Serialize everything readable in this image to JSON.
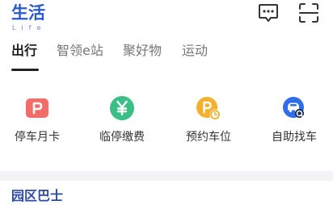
{
  "header": {
    "title": "生活",
    "subtitle": "Life",
    "icons": {
      "message": "message-icon",
      "scan": "scan-icon"
    },
    "brand_color": "#2a58d3"
  },
  "tabs": [
    {
      "label": "出行",
      "active": true
    },
    {
      "label": "智领e站",
      "active": false
    },
    {
      "label": "聚好物",
      "active": false
    },
    {
      "label": "运动",
      "active": false
    }
  ],
  "services": [
    {
      "label": "停车月卡",
      "icon": "parking-card-icon",
      "color": "#f26d6a"
    },
    {
      "label": "临停缴费",
      "icon": "yuan-icon",
      "color": "#3bbf86"
    },
    {
      "label": "预约车位",
      "icon": "parking-reserve-icon",
      "color": "#f5b02d"
    },
    {
      "label": "自助找车",
      "icon": "find-car-icon",
      "color": "#2f6ee8"
    }
  ],
  "section": {
    "title": "园区巴士"
  }
}
